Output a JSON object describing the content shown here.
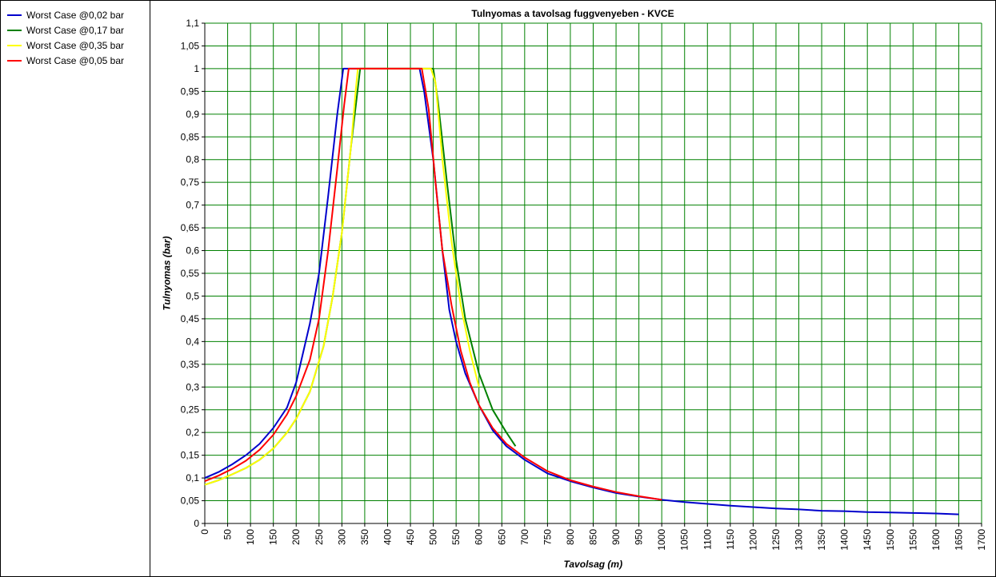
{
  "chart_data": {
    "type": "line",
    "title": "Tulnyomas a tavolsag fuggvenyeben - KVCE",
    "xlabel": "Tavolsag (m)",
    "ylabel": "Tulnyomas (bar)",
    "xlim": [
      0,
      1700
    ],
    "ylim": [
      0,
      1.1
    ],
    "x_ticks": [
      0,
      50,
      100,
      150,
      200,
      250,
      300,
      350,
      400,
      450,
      500,
      550,
      600,
      650,
      700,
      750,
      800,
      850,
      900,
      950,
      1000,
      1050,
      1100,
      1150,
      1200,
      1250,
      1300,
      1350,
      1400,
      1450,
      1500,
      1550,
      1600,
      1650,
      1700
    ],
    "y_ticks": [
      0,
      0.05,
      0.1,
      0.15,
      0.2,
      0.25,
      0.3,
      0.35,
      0.4,
      0.45,
      0.5,
      0.55,
      0.6,
      0.65,
      0.7,
      0.75,
      0.8,
      0.85,
      0.9,
      0.95,
      1,
      1.05,
      1.1
    ],
    "y_tick_labels": [
      "0",
      "0,05",
      "0,1",
      "0,15",
      "0,2",
      "0,25",
      "0,3",
      "0,35",
      "0,4",
      "0,45",
      "0,5",
      "0,55",
      "0,6",
      "0,65",
      "0,7",
      "0,75",
      "0,8",
      "0,85",
      "0,9",
      "0,95",
      "1",
      "1,05",
      "1,1"
    ],
    "grid": true,
    "legend_position": "left-panel",
    "series": [
      {
        "name": "Worst Case @0,02 bar",
        "color": "#0000cc",
        "points": [
          [
            0,
            0.1
          ],
          [
            30,
            0.113
          ],
          [
            60,
            0.13
          ],
          [
            90,
            0.15
          ],
          [
            120,
            0.175
          ],
          [
            150,
            0.21
          ],
          [
            180,
            0.255
          ],
          [
            200,
            0.31
          ],
          [
            230,
            0.44
          ],
          [
            250,
            0.55
          ],
          [
            270,
            0.72
          ],
          [
            290,
            0.9
          ],
          [
            303,
            1
          ],
          [
            470,
            1
          ],
          [
            480,
            0.95
          ],
          [
            500,
            0.8
          ],
          [
            520,
            0.6
          ],
          [
            535,
            0.47
          ],
          [
            550,
            0.4
          ],
          [
            570,
            0.33
          ],
          [
            600,
            0.26
          ],
          [
            630,
            0.205
          ],
          [
            660,
            0.17
          ],
          [
            700,
            0.14
          ],
          [
            750,
            0.11
          ],
          [
            800,
            0.093
          ],
          [
            850,
            0.079
          ],
          [
            900,
            0.067
          ],
          [
            950,
            0.059
          ],
          [
            1000,
            0.052
          ],
          [
            1050,
            0.047
          ],
          [
            1100,
            0.043
          ],
          [
            1150,
            0.039
          ],
          [
            1200,
            0.036
          ],
          [
            1250,
            0.033
          ],
          [
            1300,
            0.031
          ],
          [
            1350,
            0.028
          ],
          [
            1400,
            0.027
          ],
          [
            1450,
            0.025
          ],
          [
            1500,
            0.024
          ],
          [
            1550,
            0.023
          ],
          [
            1600,
            0.022
          ],
          [
            1650,
            0.02
          ]
        ]
      },
      {
        "name": "Worst Case @0,17 bar",
        "color": "#008000",
        "points": [
          [
            0,
            0.085
          ],
          [
            30,
            0.095
          ],
          [
            60,
            0.108
          ],
          [
            90,
            0.122
          ],
          [
            120,
            0.14
          ],
          [
            150,
            0.165
          ],
          [
            180,
            0.2
          ],
          [
            200,
            0.23
          ],
          [
            230,
            0.29
          ],
          [
            260,
            0.39
          ],
          [
            280,
            0.5
          ],
          [
            300,
            0.64
          ],
          [
            320,
            0.83
          ],
          [
            340,
            1
          ],
          [
            500,
            1
          ],
          [
            510,
            0.93
          ],
          [
            530,
            0.75
          ],
          [
            550,
            0.58
          ],
          [
            570,
            0.45
          ],
          [
            600,
            0.33
          ],
          [
            630,
            0.25
          ],
          [
            660,
            0.2
          ],
          [
            680,
            0.17
          ]
        ]
      },
      {
        "name": "Worst Case @0,35 bar",
        "color": "#ffff00",
        "points": [
          [
            0,
            0.085
          ],
          [
            30,
            0.095
          ],
          [
            60,
            0.108
          ],
          [
            90,
            0.122
          ],
          [
            120,
            0.14
          ],
          [
            150,
            0.165
          ],
          [
            180,
            0.2
          ],
          [
            200,
            0.23
          ],
          [
            230,
            0.29
          ],
          [
            260,
            0.39
          ],
          [
            280,
            0.5
          ],
          [
            300,
            0.64
          ],
          [
            320,
            0.83
          ],
          [
            330,
            0.95
          ],
          [
            335,
            1
          ],
          [
            495,
            1
          ],
          [
            505,
            0.97
          ],
          [
            520,
            0.8
          ],
          [
            540,
            0.62
          ],
          [
            560,
            0.48
          ],
          [
            580,
            0.38
          ],
          [
            600,
            0.3
          ]
        ]
      },
      {
        "name": "Worst Case @0,05 bar",
        "color": "#ff0000",
        "points": [
          [
            0,
            0.093
          ],
          [
            30,
            0.105
          ],
          [
            60,
            0.12
          ],
          [
            90,
            0.138
          ],
          [
            120,
            0.162
          ],
          [
            150,
            0.195
          ],
          [
            180,
            0.24
          ],
          [
            200,
            0.28
          ],
          [
            230,
            0.36
          ],
          [
            250,
            0.45
          ],
          [
            270,
            0.6
          ],
          [
            290,
            0.78
          ],
          [
            305,
            0.92
          ],
          [
            315,
            1
          ],
          [
            475,
            1
          ],
          [
            490,
            0.91
          ],
          [
            505,
            0.75
          ],
          [
            520,
            0.6
          ],
          [
            540,
            0.48
          ],
          [
            560,
            0.38
          ],
          [
            580,
            0.31
          ],
          [
            600,
            0.26
          ],
          [
            630,
            0.21
          ],
          [
            660,
            0.175
          ],
          [
            700,
            0.145
          ],
          [
            750,
            0.115
          ],
          [
            800,
            0.095
          ],
          [
            850,
            0.081
          ],
          [
            900,
            0.069
          ],
          [
            950,
            0.06
          ],
          [
            1000,
            0.052
          ]
        ]
      }
    ]
  }
}
